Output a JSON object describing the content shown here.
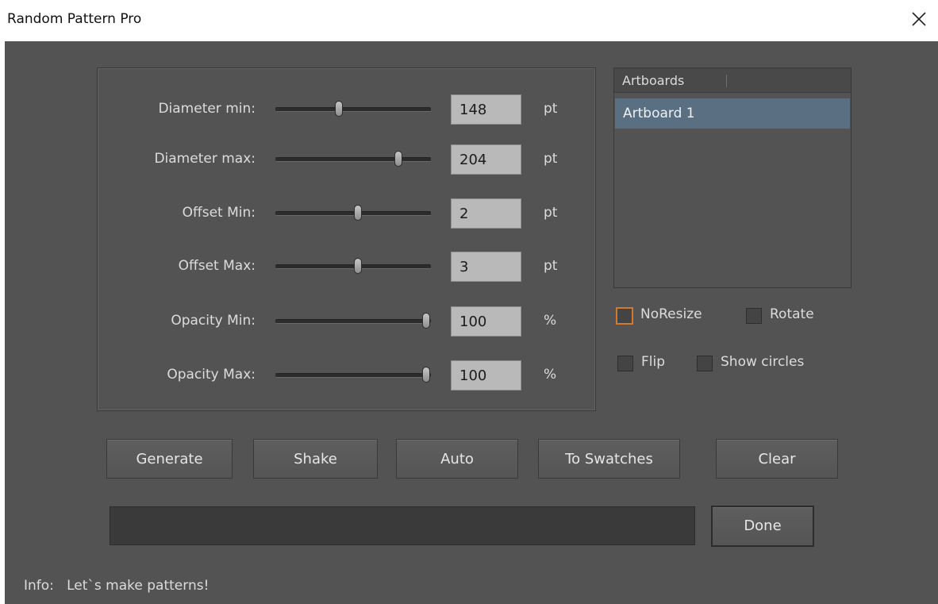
{
  "window": {
    "title": "Random Pattern Pro"
  },
  "params": [
    {
      "label": "Diameter min:",
      "value": "148",
      "unit": "pt",
      "slider_fraction": 0.41
    },
    {
      "label": "Diameter max:",
      "value": "204",
      "unit": "pt",
      "slider_fraction": 0.79
    },
    {
      "label": "Offset Min:",
      "value": "2",
      "unit": "pt",
      "slider_fraction": 0.53
    },
    {
      "label": "Offset Max:",
      "value": "3",
      "unit": "pt",
      "slider_fraction": 0.53
    },
    {
      "label": "Opacity Min:",
      "value": "100",
      "unit": "%",
      "slider_fraction": 0.97
    },
    {
      "label": "Opacity Max:",
      "value": "100",
      "unit": "%",
      "slider_fraction": 0.97
    }
  ],
  "artboards": {
    "header": "Artboards",
    "items": [
      "Artboard 1"
    ],
    "selected_index": 0
  },
  "options": {
    "noresize": {
      "label": "NoResize",
      "checked": false,
      "focused": true
    },
    "rotate": {
      "label": "Rotate",
      "checked": false
    },
    "flip": {
      "label": "Flip",
      "checked": false
    },
    "show_circles": {
      "label": "Show circles",
      "checked": false
    }
  },
  "buttons": {
    "generate": "Generate",
    "shake": "Shake",
    "auto": "Auto",
    "to_swatches": "To Swatches",
    "clear": "Clear",
    "done": "Done"
  },
  "progress": {
    "fraction": 0
  },
  "info": {
    "label": "Info:",
    "text": "Let`s make patterns!"
  },
  "colors": {
    "panel_bg": "#535353",
    "selection": "#5b6f82",
    "focus": "#cf7a2f"
  }
}
